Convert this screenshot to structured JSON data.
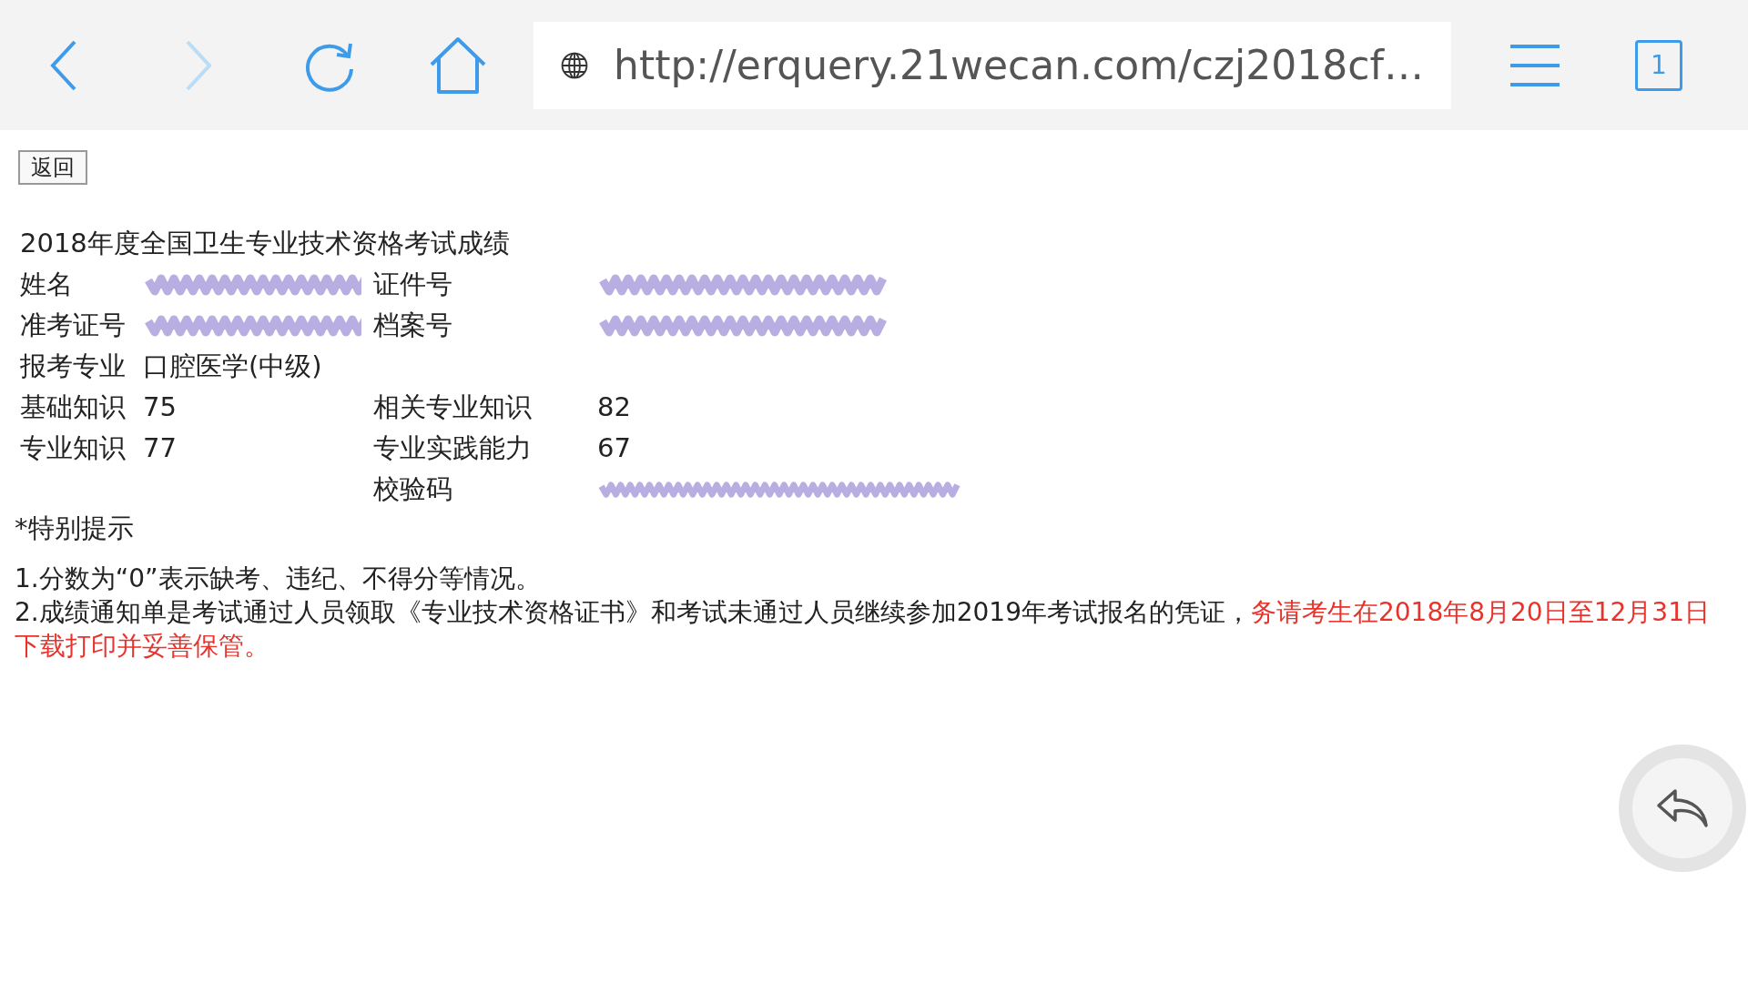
{
  "toolbar": {
    "back_disabled": false,
    "forward_disabled": true,
    "url": "http://erquery.21wecan.com/czj2018cf…",
    "tab_count": "1"
  },
  "back_button": "返回",
  "title": "2018年度全国卫生专业技术资格考试成绩",
  "rows": [
    {
      "cells": [
        {
          "kind": "text",
          "text": "姓名"
        },
        {
          "kind": "redacted"
        },
        {
          "kind": "text",
          "text": "证件号"
        },
        {
          "kind": "redacted"
        }
      ]
    },
    {
      "cells": [
        {
          "kind": "text",
          "text": "准考证号"
        },
        {
          "kind": "redacted"
        },
        {
          "kind": "text",
          "text": "档案号"
        },
        {
          "kind": "redacted"
        }
      ]
    },
    {
      "cells": [
        {
          "kind": "text",
          "text": "报考专业"
        },
        {
          "kind": "text",
          "text": "口腔医学(中级)"
        }
      ]
    },
    {
      "cells": [
        {
          "kind": "text",
          "text": "基础知识"
        },
        {
          "kind": "text",
          "text": "75"
        },
        {
          "kind": "text",
          "text": "相关专业知识"
        },
        {
          "kind": "text",
          "text": "82"
        }
      ]
    },
    {
      "cells": [
        {
          "kind": "text",
          "text": "专业知识"
        },
        {
          "kind": "text",
          "text": "77"
        },
        {
          "kind": "text",
          "text": "专业实践能力"
        },
        {
          "kind": "text",
          "text": "67"
        }
      ]
    },
    {
      "cells": [
        {
          "kind": "empty"
        },
        {
          "kind": "empty"
        },
        {
          "kind": "text",
          "text": "校验码"
        },
        {
          "kind": "redacted"
        }
      ]
    }
  ],
  "notice_heading": "*特别提示",
  "notes": [
    {
      "text": "1.分数为“0”表示缺考、违纪、不得分等情况。"
    },
    {
      "text": "2.成绩通知单是考试通过人员领取《专业技术资格证书》和考试未通过人员继续参加2019年考试报名的凭证，",
      "highlight": "务请考生在2018年8月20日至12月31日下载打印并妥善保管。"
    }
  ]
}
